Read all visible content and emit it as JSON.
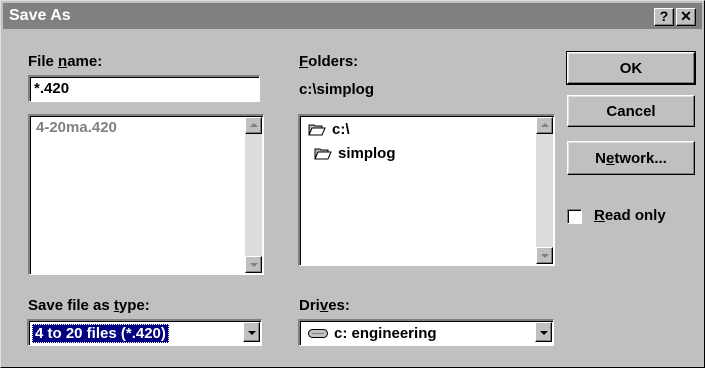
{
  "window": {
    "title": "Save As"
  },
  "title_buttons": {
    "help": "?",
    "close": "✕"
  },
  "file_name": {
    "label_pre": "File ",
    "label_ul": "n",
    "label_post": "ame:",
    "value": "*.420",
    "list": [
      "4-20ma.420"
    ]
  },
  "folders": {
    "label_ul": "F",
    "label_post": "olders:",
    "path": "c:\\simplog",
    "items": [
      "c:\\",
      "simplog"
    ]
  },
  "save_type": {
    "label_pre": "Save file as ",
    "label_ul": "t",
    "label_post": "ype:",
    "value": "4 to 20 files (*.420)"
  },
  "drives": {
    "label_pre": "Dri",
    "label_ul": "v",
    "label_post": "es:",
    "value": "c: engineering"
  },
  "buttons": {
    "ok": "OK",
    "cancel": "Cancel",
    "network_pre": "N",
    "network_ul": "e",
    "network_post": "twork..."
  },
  "read_only": {
    "label_ul": "R",
    "label_post": "ead only",
    "checked": false
  },
  "colors": {
    "face": "#c0c0c0",
    "title_bar": "#808080",
    "selection": "#000080",
    "disabled_text": "#808080"
  }
}
